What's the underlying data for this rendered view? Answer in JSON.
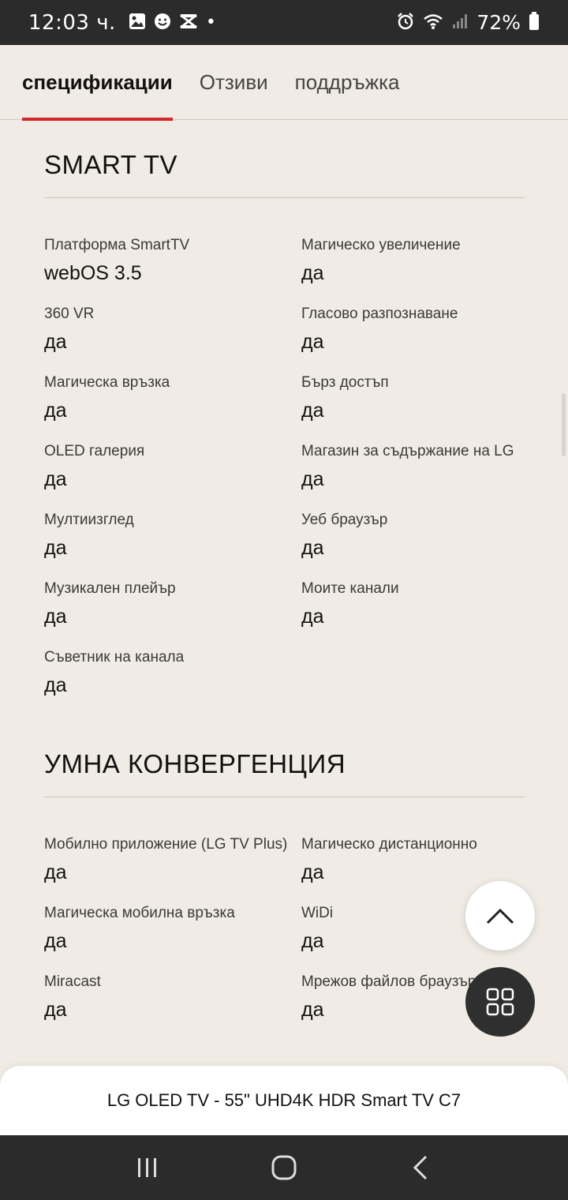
{
  "status_bar": {
    "time": "12:03 ч.",
    "dot": "•",
    "battery": "72%",
    "icons": [
      "gallery-icon",
      "smiley-icon",
      "capcut-icon",
      "alarm-icon",
      "wifi-icon",
      "signal-icon",
      "battery-icon"
    ]
  },
  "tabs": [
    {
      "label": "спецификации",
      "active": true
    },
    {
      "label": "Отзиви",
      "active": false
    },
    {
      "label": "поддръжка",
      "active": false
    }
  ],
  "sections": [
    {
      "title": "SMART TV",
      "specs": [
        {
          "label": "Платформа SmartTV",
          "value": "webOS 3.5"
        },
        {
          "label": "Магическо увеличение",
          "value": "да"
        },
        {
          "label": "360 VR",
          "value": "да"
        },
        {
          "label": "Гласово разпознаване",
          "value": "да"
        },
        {
          "label": "Магическа връзка",
          "value": "да"
        },
        {
          "label": "Бърз достъп",
          "value": "да"
        },
        {
          "label": "OLED галерия",
          "value": "да"
        },
        {
          "label": "Магазин за съдържание на LG",
          "value": "да"
        },
        {
          "label": "Мултиизглед",
          "value": "да"
        },
        {
          "label": "Уеб браузър",
          "value": "да"
        },
        {
          "label": "Музикален плейър",
          "value": "да"
        },
        {
          "label": "Моите канали",
          "value": "да"
        },
        {
          "label": "Съветник на канала",
          "value": "да"
        }
      ]
    },
    {
      "title": "УМНА КОНВЕРГЕНЦИЯ",
      "specs": [
        {
          "label": "Мобилно приложение (LG TV Plus)",
          "value": "да"
        },
        {
          "label": "Магическо дистанционно",
          "value": "да"
        },
        {
          "label": "Магическа мобилна връзка",
          "value": "да"
        },
        {
          "label": "WiDi",
          "value": "да"
        },
        {
          "label": "Miracast",
          "value": "да"
        },
        {
          "label": "Мрежов файлов браузър",
          "value": "да"
        }
      ]
    }
  ],
  "product_bar": {
    "title": "LG OLED TV - 55\" UHD4K HDR Smart TV C7"
  },
  "colors": {
    "accent": "#d3262c",
    "background": "#f0ece5",
    "dark": "#2b2b2b"
  }
}
